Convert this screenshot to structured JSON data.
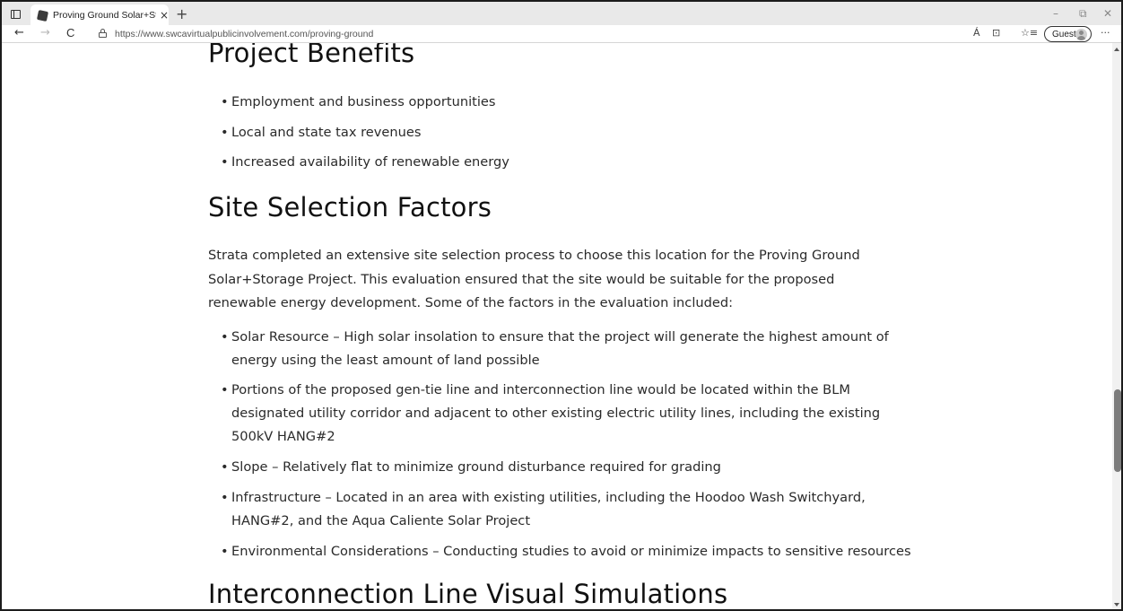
{
  "browser": {
    "tab_title": "Proving Ground Solar+Storage P",
    "tab_close": "×",
    "new_tab": "+",
    "url": "https://www.swcavirtualpublicinvolvement.com/proving-ground",
    "guest_label": "Guest",
    "window_controls": {
      "minimize": "–",
      "restore": "⧉",
      "close": "✕"
    },
    "nav": {
      "back": "←",
      "forward": "→",
      "refresh": "C"
    },
    "right_icons": {
      "read_aloud": "Á",
      "immersive": "⊡",
      "favorites": "☆≡",
      "more": "···"
    }
  },
  "page": {
    "benefits_heading": "Project Benefits",
    "benefits": [
      "Employment and business opportunities",
      "Local and state tax revenues",
      "Increased availability of renewable energy"
    ],
    "site_heading": "Site Selection Factors",
    "site_paragraph": "Strata completed an extensive site selection process to choose this location for the Proving Ground Solar+Storage Project. This evaluation ensured that the site would be suitable for the proposed renewable energy development. Some of the factors in the evaluation included:",
    "factors": [
      "Solar Resource – High solar insolation to ensure that the project will generate the highest amount of energy using the least amount of land possible",
      "Portions of the proposed gen-tie line and interconnection line would be located within the BLM designated utility corridor and adjacent to other existing electric utility lines, including the existing 500kV HANG#2",
      "Slope – Relatively flat to minimize ground disturbance required for grading",
      "Infrastructure – Located in an area with existing utilities, including the Hoodoo Wash Switchyard, HANG#2, and the Aqua Caliente Solar Project",
      "Environmental Considerations – Conducting studies to avoid or minimize impacts to sensitive resources"
    ],
    "interconnection_heading": "Interconnection Line Visual Simulations"
  }
}
